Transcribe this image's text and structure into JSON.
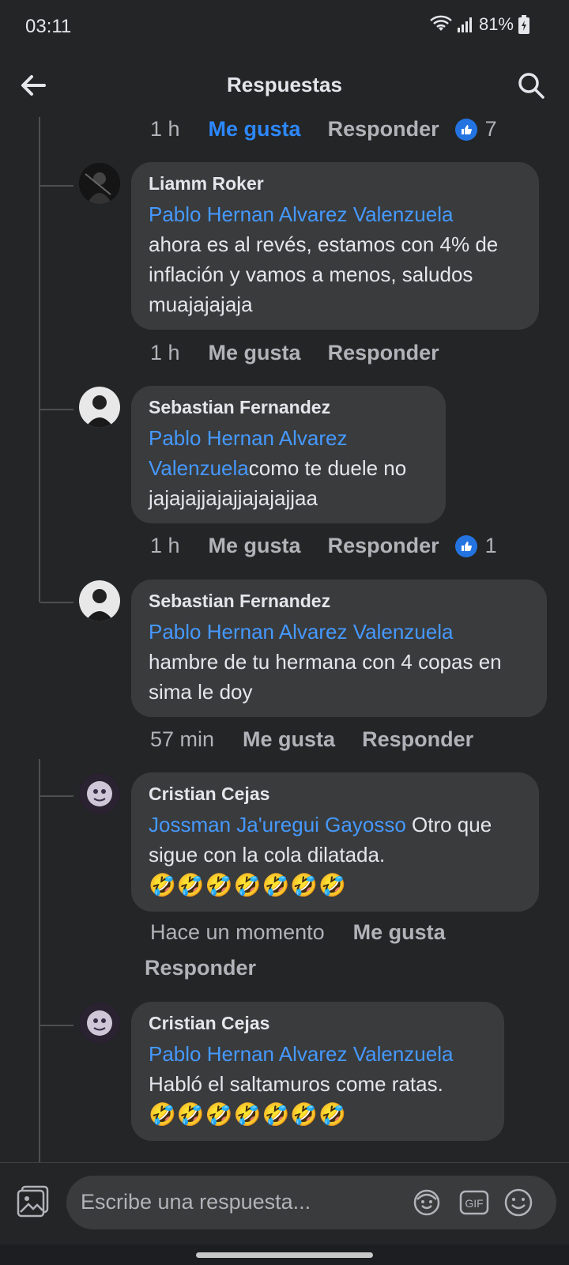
{
  "status": {
    "time": "03:11",
    "battery": "81%"
  },
  "header": {
    "title": "Respuestas"
  },
  "thread": {
    "top_meta": {
      "time": "1 h",
      "like": "Me gusta",
      "reply": "Responder",
      "reactions": "7"
    },
    "comments": [
      {
        "name": "Liamm Roker",
        "mention": "Pablo Hernan Alvarez Valenzuela",
        "text": "ahora es al revés, estamos con 4% de inflación y vamos a menos, saludos muajajajaja",
        "meta": {
          "time": "1 h",
          "like": "Me gusta",
          "reply": "Responder"
        }
      },
      {
        "name": "Sebastian Fernandez",
        "mention": "Pablo Hernan Alvarez Valenzuela",
        "text": "como te duele no jajajajjajajjajajajjaa",
        "meta": {
          "time": "1 h",
          "like": "Me gusta",
          "reply": "Responder",
          "reactions": "1"
        }
      },
      {
        "name": "Sebastian Fernandez",
        "mention": "Pablo Hernan Alvarez Valenzuela",
        "text": "hambre de tu hermana con 4 copas en sima le doy",
        "meta": {
          "time": "57 min",
          "like": "Me gusta",
          "reply": "Responder"
        }
      },
      {
        "name": "Cristian Cejas",
        "mention": "Jossman Ja'uregui Gayosso",
        "text": " Otro que sigue con la cola dilatada.",
        "emojis": "🤣🤣🤣🤣🤣🤣🤣",
        "meta": {
          "time": "Hace un momento",
          "like": "Me gusta",
          "reply": "Responder"
        }
      },
      {
        "name": "Cristian Cejas",
        "mention": "Pablo Hernan Alvarez Valenzuela",
        "text": "Habló el saltamuros come ratas.",
        "emojis": "🤣🤣🤣🤣🤣🤣🤣"
      }
    ]
  },
  "composer": {
    "placeholder": "Escribe una respuesta..."
  },
  "colors": {
    "background": "#242526",
    "bubble": "#3a3b3c",
    "mention": "#4599ff",
    "active_like": "#2d88ff"
  }
}
